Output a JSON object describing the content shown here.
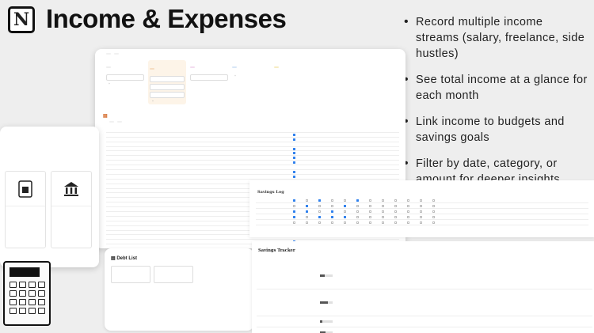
{
  "header": {
    "logo_letter": "N",
    "title": "Income & Expenses"
  },
  "bullets": [
    "Record multiple income streams (salary, freelance, side hustles)",
    "See total income at a glance for each month",
    "Link income to budgets and savings goals",
    "Filter by date, category, or amount for deeper insights"
  ],
  "icons": {
    "logo": "notion-logo",
    "expenses": "receipt-icon",
    "debt": "ledger-icon",
    "bank": "bank-icon",
    "wallet": "wallet-icon"
  },
  "colors": {
    "background": "#eeeeee",
    "accent_blue": "#2f80ed",
    "accent_orange": "#d46a2a"
  },
  "debt": {
    "title": "Debt List"
  },
  "savings_log": {
    "title": "Savings Log"
  },
  "savings_tracker": {
    "title": "Savings Tracker"
  }
}
